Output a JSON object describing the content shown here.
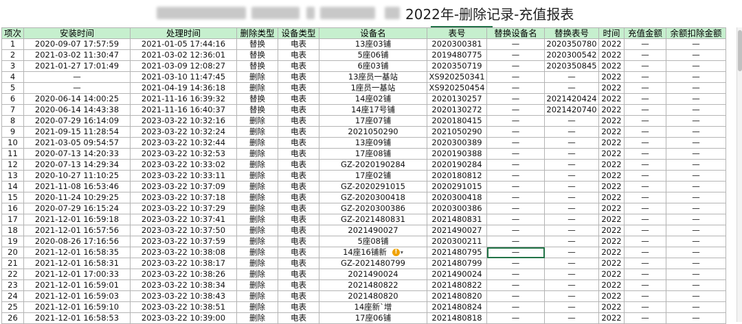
{
  "title": "2022年-删除记录-充值报表",
  "headers": [
    "项次",
    "安装时间",
    "处理时间",
    "删除类型",
    "设备类型",
    "设备名",
    "表号",
    "替换设备名",
    "替换表号",
    "时间",
    "充值金额",
    "余额扣除金额"
  ],
  "rows": [
    [
      "1",
      "2020-09-07 17:57:59",
      "2021-01-05 17:44:16",
      "替换",
      "电表",
      "13座03铺",
      "2020300381",
      "—",
      "2020350780",
      "2022",
      "—",
      "—"
    ],
    [
      "2",
      "2021-03-02 11:30:47",
      "2021-03-02 12:36:01",
      "替换",
      "电表",
      "5座06铺",
      "2019480775",
      "—",
      "2020300542",
      "2022",
      "—",
      "—"
    ],
    [
      "3",
      "2021-01-27 17:01:49",
      "2021-03-09 12:08:27",
      "替换",
      "电表",
      "6座03铺",
      "2020350719",
      "—",
      "2020350845",
      "2022",
      "—",
      "—"
    ],
    [
      "4",
      "—",
      "2021-03-10 11:47:45",
      "删除",
      "电表",
      "13座员一基站",
      "XS920250341",
      "—",
      "—",
      "2022",
      "—",
      "—"
    ],
    [
      "5",
      "—",
      "2021-04-19 14:36:18",
      "删除",
      "电表",
      "1座员一基站",
      "XS920250454",
      "—",
      "—",
      "2022",
      "—",
      "—"
    ],
    [
      "6",
      "2020-06-14 14:00:25",
      "2021-11-16 16:39:32",
      "替换",
      "电表",
      "14座02铺",
      "2020130257",
      "—",
      "2021420424",
      "2022",
      "—",
      "—"
    ],
    [
      "7",
      "2020-06-14 14:43:38",
      "2021-11-16 16:40:37",
      "替换",
      "电表",
      "14座17号铺",
      "2020130272",
      "—",
      "2021420740",
      "2022",
      "—",
      "—"
    ],
    [
      "8",
      "2020-07-29 16:14:09",
      "2023-03-22 10:32:16",
      "删除",
      "电表",
      "17座07铺",
      "2020180415",
      "—",
      "—",
      "2022",
      "—",
      "—"
    ],
    [
      "9",
      "2021-09-15 11:28:54",
      "2023-03-22 10:32:24",
      "删除",
      "电表",
      "2021050290",
      "2021050290",
      "—",
      "—",
      "2022",
      "—",
      "—"
    ],
    [
      "10",
      "2021-03-05 09:54:57",
      "2023-03-22 10:32:44",
      "删除",
      "电表",
      "13座09铺",
      "2020300389",
      "—",
      "—",
      "2022",
      "—",
      "—"
    ],
    [
      "11",
      "2020-07-13 14:20:33",
      "2023-03-22 10:32:53",
      "删除",
      "电表",
      "17座08铺",
      "2020190388",
      "—",
      "—",
      "2022",
      "—",
      "—"
    ],
    [
      "12",
      "2020-07-13 14:29:34",
      "2023-03-22 10:33:02",
      "删除",
      "电表",
      "GZ-2020190284",
      "2020190284",
      "—",
      "—",
      "2022",
      "—",
      "—"
    ],
    [
      "13",
      "2020-10-27 11:10:25",
      "2023-03-22 10:33:11",
      "删除",
      "电表",
      "17座02铺",
      "2020180812",
      "—",
      "—",
      "2022",
      "—",
      "—"
    ],
    [
      "14",
      "2021-11-08 16:53:46",
      "2023-03-22 10:37:09",
      "删除",
      "电表",
      "GZ-2020291015",
      "2020291015",
      "—",
      "—",
      "2022",
      "—",
      "—"
    ],
    [
      "15",
      "2020-11-24 10:29:25",
      "2023-03-22 10:37:18",
      "删除",
      "电表",
      "GZ-2020300418",
      "2020300418",
      "—",
      "—",
      "2022",
      "—",
      "—"
    ],
    [
      "16",
      "2020-07-29 16:15:24",
      "2023-03-22 10:37:29",
      "删除",
      "电表",
      "GZ-2020300386",
      "2020300386",
      "—",
      "—",
      "2022",
      "—",
      "—"
    ],
    [
      "17",
      "2021-12-01 16:59:18",
      "2023-03-22 10:37:41",
      "删除",
      "电表",
      "GZ-2021480831",
      "2021480831",
      "—",
      "—",
      "2022",
      "—",
      "—"
    ],
    [
      "18",
      "2021-12-01 16:57:56",
      "2023-03-22 10:37:50",
      "删除",
      "电表",
      "2021490027",
      "2021490027",
      "—",
      "—",
      "2022",
      "—",
      "—"
    ],
    [
      "19",
      "2020-08-26 17:16:56",
      "2023-03-22 10:37:59",
      "删除",
      "电表",
      "5座08铺",
      "2020300211",
      "—",
      "—",
      "2022",
      "—",
      "—"
    ],
    [
      "20",
      "2021-12-01 16:58:35",
      "2023-03-22 10:38:08",
      "删除",
      "电表",
      "14座16铺新",
      "2021480795",
      "—",
      "—",
      "2022",
      "—",
      "—"
    ],
    [
      "21",
      "2021-12-01 16:58:31",
      "2023-03-22 10:38:17",
      "删除",
      "电表",
      "GZ-2021480799",
      "2021480799",
      "—",
      "—",
      "2022",
      "—",
      "—"
    ],
    [
      "22",
      "2021-12-01 17:00:33",
      "2023-03-22 10:38:26",
      "删除",
      "电表",
      "2021490024",
      "2021490024",
      "—",
      "—",
      "2022",
      "—",
      "—"
    ],
    [
      "23",
      "2021-12-01 16:59:01",
      "2023-03-22 10:38:34",
      "删除",
      "电表",
      "2021480822",
      "2021480822",
      "—",
      "—",
      "2022",
      "—",
      "—"
    ],
    [
      "24",
      "2021-12-01 16:59:03",
      "2023-03-22 10:38:43",
      "删除",
      "电表",
      "2021480820",
      "2021480820",
      "—",
      "—",
      "2022",
      "—",
      "—"
    ],
    [
      "25",
      "2021-12-01 16:59:10",
      "2023-03-22 10:38:51",
      "删除",
      "电表",
      "14座新`增",
      "2021480824",
      "—",
      "—",
      "2022",
      "—",
      "—"
    ],
    [
      "26",
      "2021-12-01 16:58:53",
      "2023-03-22 10:39:00",
      "删除",
      "电表",
      "17座06铺",
      "2021480818",
      "—",
      "—",
      "2022",
      "—",
      "—"
    ]
  ],
  "selected_cell": {
    "row": 20,
    "col": 7
  },
  "warning_icon": "exclamation-warning-icon",
  "colors": {
    "header_bg": "#c6efce",
    "selection": "#217346",
    "warning": "#f0a202"
  }
}
